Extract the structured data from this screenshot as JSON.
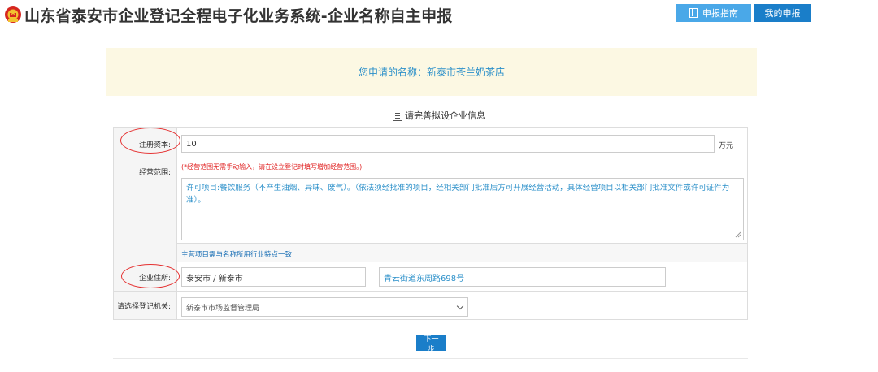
{
  "header": {
    "title": "山东省泰安市企业登记全程电子化业务系统-企业名称自主申报",
    "guide_button": "申报指南",
    "my_button": "我的申报",
    "emblem_icon": "national-emblem-icon"
  },
  "banner": {
    "text": "您申请的名称：新泰市苍兰奶茶店"
  },
  "section": {
    "title": "请完善拟设企业信息",
    "icon": "form-icon"
  },
  "form": {
    "capital": {
      "label": "注册资本:",
      "value": "10",
      "unit": "万元"
    },
    "scope": {
      "label": "经营范围:",
      "hint": "(*经营范围无需手动输入，请在设立登记时填写增加经营范围。)",
      "value": "许可项目:餐饮服务（不产生油烟、异味、废气）。（依法须经批准的项目，经相关部门批准后方可开展经营活动，具体经营项目以相关部门批准文件或许可证件为准）。",
      "note": "主营项目需与名称所用行业特点一致"
    },
    "address": {
      "label": "企业住所:",
      "region": "泰安市 / 新泰市",
      "street": "青云街道东周路698号"
    },
    "authority": {
      "label": "请选择登记机关:",
      "selected": "新泰市市场监督管理局"
    }
  },
  "actions": {
    "next": "下一步"
  },
  "colors": {
    "primary": "#1a7ec9",
    "light_primary": "#4aa8e8",
    "banner_bg": "#fcf8e3",
    "hint_red": "#e02020",
    "annotation_red": "#e53030"
  }
}
